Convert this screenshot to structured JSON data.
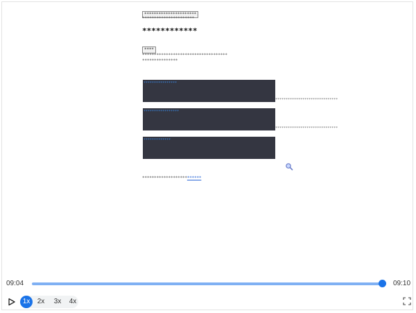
{
  "document": {
    "top_badge": "**********************",
    "top_sub": "**********************",
    "heading": "************",
    "small_badge": "****",
    "line1": "************************************",
    "line2": "***************",
    "blocks": [
      {
        "label": "****************",
        "side": "******************************"
      },
      {
        "label": "*****************",
        "side": "******************************"
      },
      {
        "label": "*************",
        "side": ""
      }
    ],
    "footer_text": "*******************",
    "footer_link": "******"
  },
  "player": {
    "current_time": "09:04",
    "total_time": "09:10",
    "progress": 0.99,
    "speeds": [
      "1x",
      "2x",
      "3x",
      "4x"
    ],
    "active_speed": "1x",
    "accent": "#1a73e8",
    "track_color": "#7fb0f3"
  },
  "icons": {
    "play": "play-icon",
    "fullscreen": "fullscreen-icon",
    "cursor": "magnifier-cursor-icon"
  }
}
